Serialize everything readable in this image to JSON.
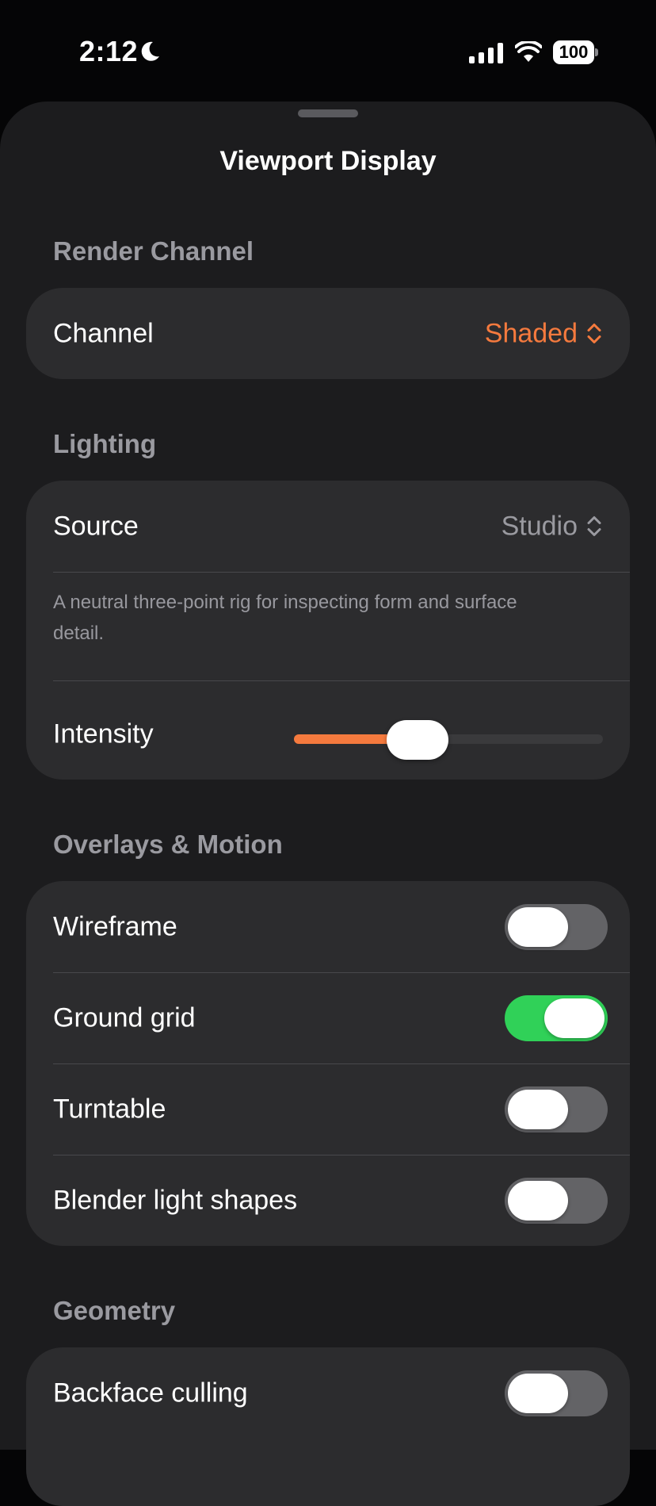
{
  "status_bar": {
    "time": "2:12",
    "battery_level": "100",
    "icons": [
      "moon-icon",
      "cellular-signal-icon",
      "wifi-icon",
      "battery-icon"
    ]
  },
  "sheet": {
    "title": "Viewport Display"
  },
  "render_channel": {
    "header": "Render Channel",
    "channel_label": "Channel",
    "channel_value": "Shaded"
  },
  "lighting": {
    "header": "Lighting",
    "source_label": "Source",
    "source_value": "Studio",
    "description": "A neutral three-point rig for inspecting form and surface detail.",
    "intensity_label": "Intensity",
    "intensity_value": 0.4
  },
  "overlays": {
    "header": "Overlays & Motion",
    "items": [
      {
        "label": "Wireframe",
        "on": false
      },
      {
        "label": "Ground grid",
        "on": true
      },
      {
        "label": "Turntable",
        "on": false
      },
      {
        "label": "Blender light shapes",
        "on": false
      }
    ]
  },
  "geometry": {
    "header": "Geometry",
    "items": [
      {
        "label": "Backface culling",
        "on": false
      }
    ]
  },
  "colors": {
    "accent": "#f57a3e",
    "toggle_on": "#30d158",
    "toggle_off": "#636366",
    "secondary_value": "#9a9aa0"
  }
}
